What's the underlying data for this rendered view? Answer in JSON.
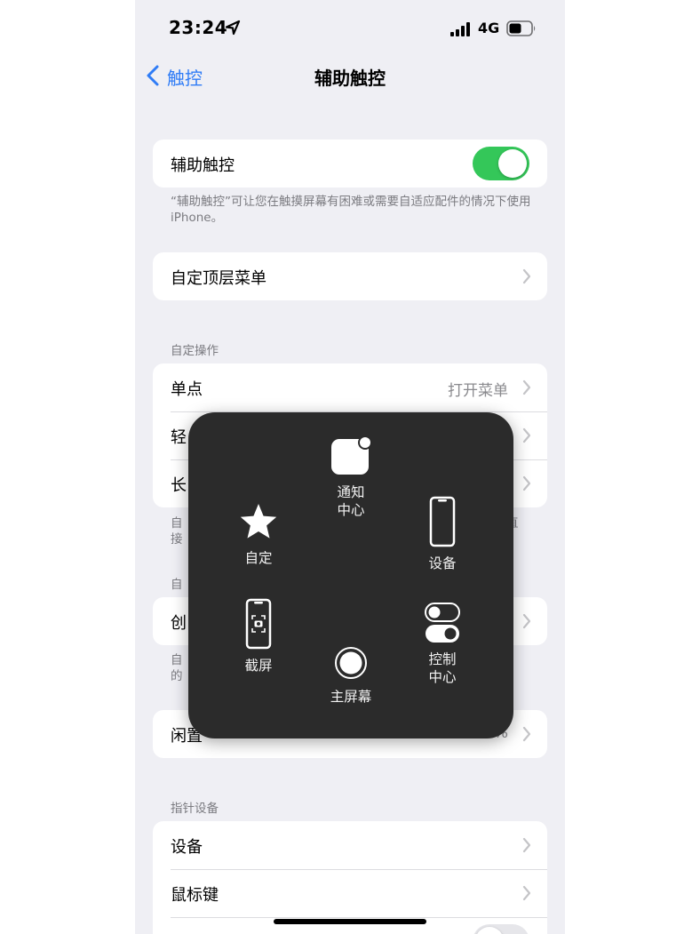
{
  "status_bar": {
    "time": "23:24",
    "network": "4G",
    "icons": [
      "location-arrow-icon",
      "signal-icon",
      "battery-icon"
    ]
  },
  "nav": {
    "back_label": "触控",
    "title": "辅助触控"
  },
  "assistive_touch": {
    "label": "辅助触控",
    "enabled": true,
    "footer": "“辅助触控”可让您在触摸屏幕有困难或需要自适应配件的情况下使用iPhone。"
  },
  "customize_menu": {
    "label": "自定顶层菜单"
  },
  "custom_actions": {
    "header": "自定操作",
    "rows": [
      {
        "label": "单点",
        "value": "打开菜单"
      },
      {
        "label": "轻"
      },
      {
        "label": "长"
      }
    ],
    "footer_partial": [
      "自",
      "接",
      "直"
    ]
  },
  "custom_gestures": {
    "header_partial": "自",
    "row_label_partial": "创",
    "footer_partial": [
      "自",
      "的"
    ]
  },
  "idle_opacity": {
    "label_partial": "闲置",
    "value_partial": "%"
  },
  "pointer_devices": {
    "header": "指针设备",
    "rows": [
      {
        "label": "设备"
      },
      {
        "label": "鼠标键"
      }
    ]
  },
  "menu_overlay": {
    "items": [
      {
        "id": "notification",
        "label": "通知\n中心",
        "icon": "notification-center-icon"
      },
      {
        "id": "custom",
        "label": "自定",
        "icon": "star-icon"
      },
      {
        "id": "device",
        "label": "设备",
        "icon": "device-icon"
      },
      {
        "id": "screenshot",
        "label": "截屏",
        "icon": "screenshot-icon"
      },
      {
        "id": "home",
        "label": "主屏幕",
        "icon": "home-button-icon"
      },
      {
        "id": "control",
        "label": "控制\n中心",
        "icon": "control-center-icon"
      }
    ]
  },
  "colors": {
    "accent": "#2f7cf6",
    "toggle_on": "#34c759",
    "background": "#efeff4",
    "panel": "#2b2b2b"
  }
}
